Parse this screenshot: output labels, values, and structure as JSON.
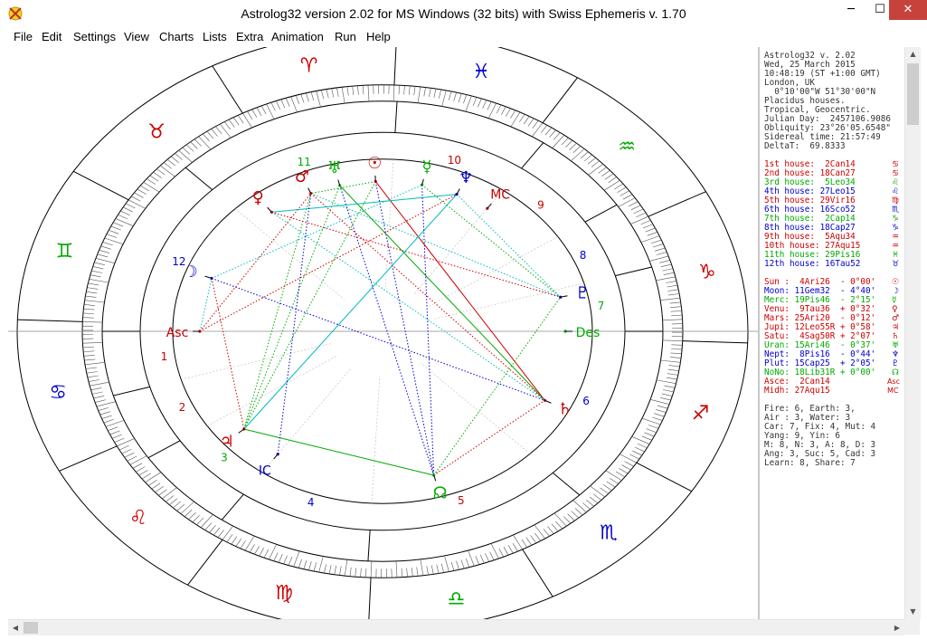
{
  "window": {
    "title": "Astrolog32 version 2.02 for MS Windows (32 bits) with Swiss Ephemeris v. 1.70",
    "min_glyph": "─",
    "max_glyph": "☐",
    "close_glyph": "✕"
  },
  "menu": {
    "items": [
      "File",
      "Edit",
      "Settings",
      "View",
      "Charts",
      "Lists",
      "Extra",
      "Animation",
      "Run",
      "Help"
    ]
  },
  "scroll_glyphs": {
    "up": "▲",
    "down": "▼",
    "left": "◀",
    "right": "▶"
  },
  "info": {
    "header": [
      "Astrolog32 v. 2.02",
      "Wed, 25 March 2015",
      "10:48:19 (ST +1:00 GMT)",
      "London, UK",
      "  0°10'00\"W 51°30'00\"N",
      "Placidus houses.",
      "Tropical, Geocentric.",
      "Julian Day:  2457106.9086",
      "Obliquity: 23°26'05.6548\"",
      "Sidereal time: 21:57:49",
      "DeltaT:  69.8333"
    ],
    "houses": [
      {
        "text": "1st house:  2Can14",
        "color": "#cc0000",
        "sign": "♋"
      },
      {
        "text": "2nd house: 18Can27",
        "color": "#cc0000",
        "sign": "♋"
      },
      {
        "text": "3rd house:  5Leo34",
        "color": "#00aa00",
        "sign": "♌"
      },
      {
        "text": "4th house: 27Leo15",
        "color": "#0000cc",
        "sign": "♌"
      },
      {
        "text": "5th house: 29Vir16",
        "color": "#cc0000",
        "sign": "♍"
      },
      {
        "text": "6th house: 16Sco52",
        "color": "#0000cc",
        "sign": "♏"
      },
      {
        "text": "7th house:  2Cap14",
        "color": "#00aa00",
        "sign": "♑"
      },
      {
        "text": "8th house: 18Cap27",
        "color": "#0000cc",
        "sign": "♑"
      },
      {
        "text": "9th house:  5Aqu34",
        "color": "#cc0000",
        "sign": "♒"
      },
      {
        "text": "10th house: 27Aqu15",
        "color": "#cc0000",
        "sign": "♒"
      },
      {
        "text": "11th house: 29Pis16",
        "color": "#00aa00",
        "sign": "♓"
      },
      {
        "text": "12th house: 16Tau52",
        "color": "#0000cc",
        "sign": "♉"
      }
    ],
    "planets": [
      {
        "text": "Sun :  4Ari26  - 0°00'",
        "color": "#cc0000",
        "sym": "☉"
      },
      {
        "text": "Moon: 11Gem32  - 4°40'",
        "color": "#0000cc",
        "sym": "☽"
      },
      {
        "text": "Merc: 19Pis46  - 2°15'",
        "color": "#00aa00",
        "sym": "☿"
      },
      {
        "text": "Venu:  9Tau36  + 0°32'",
        "color": "#cc0000",
        "sym": "♀"
      },
      {
        "text": "Mars: 25Ari20  - 0°12'",
        "color": "#cc0000",
        "sym": "♂"
      },
      {
        "text": "Jupi: 12Leo55R + 0°58'",
        "color": "#cc0000",
        "sym": "♃"
      },
      {
        "text": "Satu:  4Sag50R + 2°07'",
        "color": "#cc0000",
        "sym": "♄"
      },
      {
        "text": "Uran: 15Ari46  - 0°37'",
        "color": "#00aa00",
        "sym": "♅"
      },
      {
        "text": "Nept:  8Pis16  - 0°44'",
        "color": "#0000cc",
        "sym": "♆"
      },
      {
        "text": "Plut: 15Cap25  + 2°05'",
        "color": "#0000cc",
        "sym": "♇"
      },
      {
        "text": "NoNo: 18Lib31R + 0°00'",
        "color": "#00aa00",
        "sym": "☊"
      },
      {
        "text": "Asce:  2Can14",
        "color": "#cc0000",
        "sym": "Asc"
      },
      {
        "text": "Midh: 27Aqu15",
        "color": "#cc0000",
        "sym": "MC"
      }
    ],
    "summary": [
      "Fire: 6, Earth: 3,",
      "Air : 3, Water: 3",
      "Car: 7, Fix: 4, Mut: 4",
      "Yang: 9, Yin: 6",
      "M: 8, N: 3, A: 8, D: 3",
      "Ang: 3, Suc: 5, Cad: 3",
      "Learn: 8, Share: 7"
    ]
  },
  "wheel": {
    "asc_deg": 92.233,
    "houses": [
      {
        "label": "1",
        "deg": 92.233,
        "color": "#cc0000"
      },
      {
        "label": "2",
        "deg": 108.45,
        "color": "#cc0000"
      },
      {
        "label": "3",
        "deg": 125.567,
        "color": "#00aa00"
      },
      {
        "label": "4",
        "deg": 147.25,
        "color": "#0000cc"
      },
      {
        "label": "5",
        "deg": 179.267,
        "color": "#cc0000"
      },
      {
        "label": "6",
        "deg": 226.867,
        "color": "#0000cc"
      },
      {
        "label": "7",
        "deg": 272.233,
        "color": "#00aa00"
      },
      {
        "label": "8",
        "deg": 288.45,
        "color": "#0000cc"
      },
      {
        "label": "9",
        "deg": 305.567,
        "color": "#cc0000"
      },
      {
        "label": "10",
        "deg": 327.25,
        "color": "#cc0000"
      },
      {
        "label": "11",
        "deg": 359.267,
        "color": "#00aa00"
      },
      {
        "label": "12",
        "deg": 46.867,
        "color": "#0000cc"
      }
    ],
    "signs": [
      {
        "glyph": "♈",
        "color": "#cc0000"
      },
      {
        "glyph": "♉",
        "color": "#cc0000"
      },
      {
        "glyph": "♊",
        "color": "#00aa00"
      },
      {
        "glyph": "♋",
        "color": "#0000cc"
      },
      {
        "glyph": "♌",
        "color": "#cc0000"
      },
      {
        "glyph": "♍",
        "color": "#cc0000"
      },
      {
        "glyph": "♎",
        "color": "#00aa00"
      },
      {
        "glyph": "♏",
        "color": "#0000cc"
      },
      {
        "glyph": "♐",
        "color": "#cc0000"
      },
      {
        "glyph": "♑",
        "color": "#cc0000"
      },
      {
        "glyph": "♒",
        "color": "#00aa00"
      },
      {
        "glyph": "♓",
        "color": "#0000cc"
      }
    ],
    "planets": [
      {
        "name": "sun",
        "glyph": "☉",
        "deg": 4.433,
        "color": "#cc0000"
      },
      {
        "name": "moon",
        "glyph": "☽",
        "deg": 71.533,
        "color": "#0000cc"
      },
      {
        "name": "mercury",
        "glyph": "☿",
        "deg": 349.767,
        "color": "#00aa00"
      },
      {
        "name": "venus",
        "glyph": "♀",
        "deg": 39.6,
        "color": "#cc0000"
      },
      {
        "name": "mars",
        "glyph": "♂",
        "deg": 25.333,
        "color": "#cc0000"
      },
      {
        "name": "jupiter",
        "glyph": "♃",
        "deg": 132.917,
        "color": "#cc0000"
      },
      {
        "name": "saturn",
        "glyph": "♄",
        "deg": 244.833,
        "color": "#cc0000"
      },
      {
        "name": "uranus",
        "glyph": "♅",
        "deg": 15.767,
        "color": "#00aa00"
      },
      {
        "name": "neptune",
        "glyph": "♆",
        "deg": 338.267,
        "color": "#0000cc"
      },
      {
        "name": "pluto",
        "glyph": "♇",
        "deg": 285.417,
        "color": "#0000cc"
      },
      {
        "name": "north-node",
        "glyph": "☊",
        "deg": 198.517,
        "color": "#00aa00"
      },
      {
        "name": "ascendant",
        "glyph": "Asc",
        "deg": 92.233,
        "color": "#cc0000"
      },
      {
        "name": "midheaven",
        "glyph": "MC",
        "deg": 327.25,
        "color": "#cc0000"
      },
      {
        "name": "descendant",
        "glyph": "Des",
        "deg": 272.233,
        "color": "#00aa00"
      },
      {
        "name": "imum-coeli",
        "glyph": "IC",
        "deg": 147.25,
        "color": "#0000cc"
      }
    ],
    "aspects": [
      {
        "a": "sun",
        "b": "saturn",
        "color": "#cc0000",
        "style": "solid"
      },
      {
        "a": "sun",
        "b": "jupiter",
        "color": "#00aa00",
        "style": "dotted"
      },
      {
        "a": "sun",
        "b": "north-node",
        "color": "#0000cc",
        "style": "dotted"
      },
      {
        "a": "uranus",
        "b": "saturn",
        "color": "#00aa00",
        "style": "solid"
      },
      {
        "a": "uranus",
        "b": "jupiter",
        "color": "#00aa00",
        "style": "dotted"
      },
      {
        "a": "uranus",
        "b": "north-node",
        "color": "#0000cc",
        "style": "dotted"
      },
      {
        "a": "mars",
        "b": "saturn",
        "color": "#cc0000",
        "style": "dotted"
      },
      {
        "a": "mars",
        "b": "jupiter",
        "color": "#00aa00",
        "style": "dotted"
      },
      {
        "a": "mars",
        "b": "pluto",
        "color": "#00bbbb",
        "style": "dotted"
      },
      {
        "a": "venus",
        "b": "neptune",
        "color": "#00bbbb",
        "style": "solid"
      },
      {
        "a": "venus",
        "b": "pluto",
        "color": "#cc0000",
        "style": "dotted"
      },
      {
        "a": "venus",
        "b": "saturn",
        "color": "#00bbbb",
        "style": "dotted"
      },
      {
        "a": "moon",
        "b": "saturn",
        "color": "#0000cc",
        "style": "dotted"
      },
      {
        "a": "moon",
        "b": "mercury",
        "color": "#00bbbb",
        "style": "dotted"
      },
      {
        "a": "moon",
        "b": "jupiter",
        "color": "#cc0000",
        "style": "dotted"
      },
      {
        "a": "jupiter",
        "b": "north-node",
        "color": "#00aa00",
        "style": "solid"
      },
      {
        "a": "jupiter",
        "b": "neptune",
        "color": "#00bbbb",
        "style": "solid"
      },
      {
        "a": "north-node",
        "b": "pluto",
        "color": "#00aa00",
        "style": "dotted"
      },
      {
        "a": "north-node",
        "b": "saturn",
        "color": "#cc0000",
        "style": "dotted"
      },
      {
        "a": "mercury",
        "b": "pluto",
        "color": "#00aa00",
        "style": "dotted"
      },
      {
        "a": "mercury",
        "b": "north-node",
        "color": "#0000cc",
        "style": "dotted"
      },
      {
        "a": "neptune",
        "b": "pluto",
        "color": "#00bbbb",
        "style": "dotted"
      },
      {
        "a": "sun",
        "b": "mars",
        "color": "#00aa00",
        "style": "dotted"
      },
      {
        "a": "ascendant",
        "b": "neptune",
        "color": "#cc0000",
        "style": "dotted"
      },
      {
        "a": "ascendant",
        "b": "mars",
        "color": "#cc0000",
        "style": "dotted"
      },
      {
        "a": "ascendant",
        "b": "moon",
        "color": "#00bbbb",
        "style": "dotted"
      },
      {
        "a": "imum-coeli",
        "b": "mars",
        "color": "#0000cc",
        "style": "dotted"
      }
    ]
  }
}
